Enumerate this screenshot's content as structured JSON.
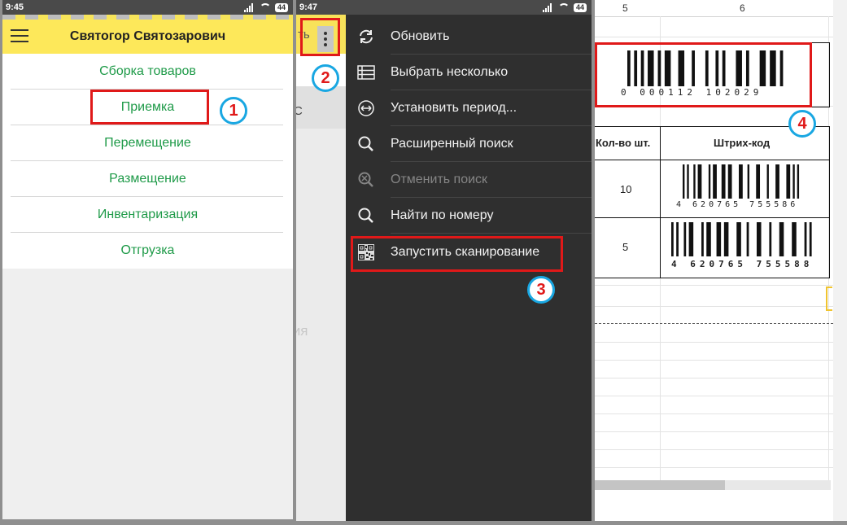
{
  "screen1": {
    "status_time": "9:45",
    "battery": "44",
    "title": "Святогор Святозарович",
    "menu": [
      "Сборка товаров",
      "Приемка",
      "Перемещение",
      "Размещение",
      "Инвентаризация",
      "Отгрузка"
    ]
  },
  "screen2": {
    "status_time": "9:47",
    "battery": "44",
    "partial_title": "ть",
    "partial_text": "С",
    "faded_text": "ция",
    "menu": [
      {
        "label": "Обновить",
        "icon": "refresh-icon",
        "enabled": true
      },
      {
        "label": "Выбрать несколько",
        "icon": "list-icon",
        "enabled": true
      },
      {
        "label": "Установить период...",
        "icon": "period-icon",
        "enabled": true
      },
      {
        "label": "Расширенный поиск",
        "icon": "search-icon",
        "enabled": true
      },
      {
        "label": "Отменить поиск",
        "icon": "cancel-search-icon",
        "enabled": false
      },
      {
        "label": "Найти по номеру",
        "icon": "find-number-icon",
        "enabled": true
      },
      {
        "label": "Запустить сканирование",
        "icon": "qr-code-icon",
        "enabled": true
      }
    ]
  },
  "screen3": {
    "col_labels": [
      "5",
      "6"
    ],
    "top_barcode": "0 000112 102029",
    "headers": {
      "qty": "Кол-во шт.",
      "barcode": "Штрих-код"
    },
    "rows": [
      {
        "qty": "10",
        "barcode": "4 620765 755586"
      },
      {
        "qty": "5",
        "barcode": "4 620765 755588"
      }
    ]
  },
  "annotations": [
    "1",
    "2",
    "3",
    "4"
  ],
  "colors": {
    "accent_yellow": "#fde85a",
    "menu_green": "#1e9a48",
    "drawer_bg": "#2f2f2f",
    "highlight_red": "#e01919",
    "badge_blue": "#19a7e2"
  }
}
